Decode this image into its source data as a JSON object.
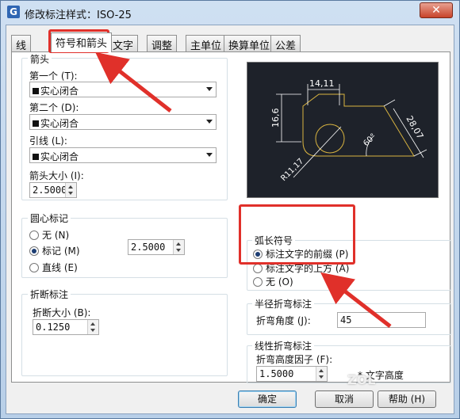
{
  "window": {
    "title": "修改标注样式：ISO-25",
    "icon": "G",
    "close_glyph": "✕"
  },
  "tabs": [
    "线",
    "符号和箭头",
    "文字",
    "调整",
    "主单位",
    "换算单位",
    "公差"
  ],
  "arrowheads": {
    "group": "箭头",
    "first_label": "第一个 (T):",
    "first_value": "实心闭合",
    "second_label": "第二个 (D):",
    "second_value": "实心闭合",
    "leader_label": "引线 (L):",
    "leader_value": "实心闭合",
    "size_label": "箭头大小 (I):",
    "size_value": "2.5000"
  },
  "center_marks": {
    "group": "圆心标记",
    "opt_none": "无 (N)",
    "opt_mark": "标记 (M)",
    "opt_line": "直线 (E)",
    "selected": "mark",
    "size_value": "2.5000"
  },
  "break": {
    "group": "折断标注",
    "size_label": "折断大小 (B):",
    "size_value": "0.1250"
  },
  "preview": {
    "dim_top": "14,11",
    "dim_left": "16,6",
    "dim_right": "28,07",
    "angle": "60°",
    "radius": "R11,17"
  },
  "arc_length": {
    "group": "弧长符号",
    "opt_prefix": "标注文字的前缀 (P)",
    "opt_above": "标注文字的上方 (A)",
    "opt_none": "无 (O)",
    "selected": "prefix"
  },
  "radius_jog": {
    "group": "半径折弯标注",
    "angle_label": "折弯角度 (J):",
    "angle_value": "45"
  },
  "linear_jog": {
    "group": "线性折弯标注",
    "height_label": "折弯高度因子 (F):",
    "height_value": "1.5000",
    "unit_text": "* 文字高度"
  },
  "buttons": {
    "ok": "确定",
    "cancel": "取消",
    "help": "帮助 (H)"
  },
  "watermark": "ZOL",
  "colors": {
    "annotation": "#e0302a",
    "preview_bg": "#1e222a",
    "preview_geometry": "#d9b440",
    "preview_dims": "#ffffff"
  }
}
